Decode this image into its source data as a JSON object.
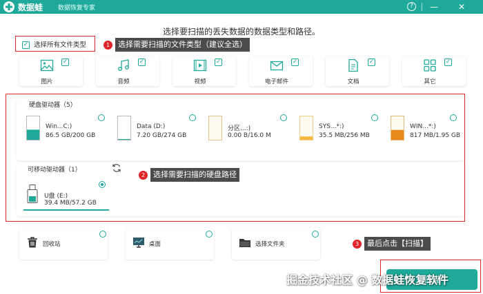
{
  "titlebar": {
    "brand": "数据蛙",
    "subtitle": "数据恢复专家",
    "help": "?",
    "minimize": "—",
    "close": "✕"
  },
  "heading": "选择要扫描的丢失数据的数据类型和路径。",
  "select_all": {
    "label": "选择所有文件类型",
    "checked": true
  },
  "annotations": [
    {
      "num": "1",
      "text": "选择需要扫描的文件类型（建议全选）"
    },
    {
      "num": "2",
      "text": "选择需要扫描的硬盘路径"
    },
    {
      "num": "3",
      "text": "最后点击【扫描】"
    }
  ],
  "file_types": [
    {
      "label": "图片",
      "icon": "image-icon",
      "checked": true
    },
    {
      "label": "音频",
      "icon": "music-icon",
      "checked": true
    },
    {
      "label": "视频",
      "icon": "video-icon",
      "checked": true
    },
    {
      "label": "电子邮件",
      "icon": "email-icon",
      "checked": true
    },
    {
      "label": "文档",
      "icon": "document-icon",
      "checked": true
    },
    {
      "label": "其它",
      "icon": "other-icon",
      "checked": true
    }
  ],
  "hard_drives": {
    "title": "硬盘驱动器（5）",
    "items": [
      {
        "name": "Win...C:)",
        "size": "86.5 GB/200 GB",
        "fill": 0.43,
        "color": "#1ea99a"
      },
      {
        "name": "Data (D:)",
        "size": "7.20 GB/274 GB",
        "fill": 0.03,
        "color": "#1ea99a"
      },
      {
        "name": "分区...:)",
        "size": "0.00  B/16.0 M",
        "fill": 0,
        "color": "#e8a54a"
      },
      {
        "name": "SYS...*:)",
        "size": "35.5 MB/256 MB",
        "fill": 0.14,
        "color": "#f5b93b"
      },
      {
        "name": "WIN...*:)",
        "size": "817 MB/1.95 GB",
        "fill": 0.42,
        "color": "#e8891a"
      }
    ]
  },
  "removable": {
    "title": "可移动驱动器（1）",
    "items": [
      {
        "name": "U盘 (E:)",
        "size": "39.4 MB/57.2 GB",
        "selected": true
      }
    ]
  },
  "locations": [
    {
      "label": "回收站",
      "icon": "recycle-bin-icon"
    },
    {
      "label": "桌面",
      "icon": "desktop-icon"
    },
    {
      "label": "选择文件夹",
      "icon": "folder-icon"
    }
  ],
  "scan_button": "扫描",
  "watermark": "掘金技术社区 @ 数据蛙恢复软件",
  "colors": {
    "accent": "#1ea99a",
    "annotation_red": "#e0262a",
    "tooltip_bg": "#4b4b4b"
  }
}
